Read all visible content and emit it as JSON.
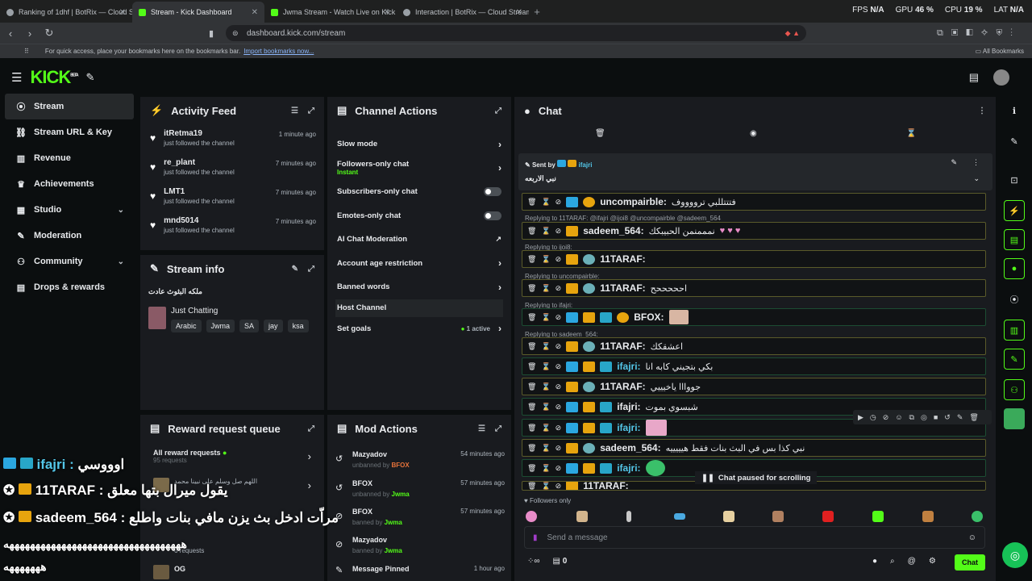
{
  "browser": {
    "tabs": [
      {
        "title": "Ranking of 1dhf | BotRix — Cloud Str"
      },
      {
        "title": "Stream - Kick Dashboard"
      },
      {
        "title": "Jwma Stream - Watch Live on Kick"
      },
      {
        "title": "Interaction | BotRix — Cloud Stream"
      }
    ],
    "url": "dashboard.kick.com/stream",
    "bookmarks_hint": "For quick access, place your bookmarks here on the bookmarks bar.",
    "import_link": "Import bookmarks now...",
    "all_bookmarks": "All Bookmarks",
    "fps_label": "FPS",
    "fps_value": "N/A",
    "gpu_label": "GPU",
    "gpu_value": "46 %",
    "cpu_label": "CPU",
    "cpu_value": "19 %",
    "lat_label": "LAT",
    "lat_value": "N/A"
  },
  "app": {
    "logo": "KICK",
    "logo_beta": "BETA"
  },
  "sidebar": {
    "items": [
      {
        "label": "Stream",
        "icon": "broadcast-icon"
      },
      {
        "label": "Stream URL & Key",
        "icon": "link-icon"
      },
      {
        "label": "Revenue",
        "icon": "bank-icon"
      },
      {
        "label": "Achievements",
        "icon": "trophy-icon"
      },
      {
        "label": "Studio",
        "icon": "grid-icon"
      },
      {
        "label": "Moderation",
        "icon": "wrench-icon"
      },
      {
        "label": "Community",
        "icon": "people-icon"
      },
      {
        "label": "Drops & rewards",
        "icon": "gift-icon"
      }
    ]
  },
  "activity": {
    "title": "Activity Feed",
    "items": [
      {
        "name": "itRetma19",
        "sub": "just followed the channel",
        "time": "1 minute ago"
      },
      {
        "name": "re_plant",
        "sub": "just followed the channel",
        "time": "7 minutes ago"
      },
      {
        "name": "LMT1",
        "sub": "just followed the channel",
        "time": "7 minutes ago"
      },
      {
        "name": "mnd5014",
        "sub": "just followed the channel",
        "time": "7 minutes ago"
      }
    ]
  },
  "stream_info": {
    "title": "Stream info",
    "stream_title": "ملكه البثوث عادت",
    "category": "Just Chatting",
    "tags": [
      "Arabic",
      "Jwma",
      "SA",
      "jay",
      "ksa"
    ]
  },
  "channel_actions": {
    "title": "Channel Actions",
    "rows": [
      {
        "label": "Slow mode",
        "sub": "",
        "kind": "arrow"
      },
      {
        "label": "Followers-only chat",
        "sub": "Instant",
        "kind": "arrow"
      },
      {
        "label": "Subscribers-only chat",
        "sub": "",
        "kind": "toggle"
      },
      {
        "label": "Emotes-only chat",
        "sub": "",
        "kind": "toggle"
      },
      {
        "label": "AI Chat Moderation",
        "sub": "",
        "kind": "external"
      },
      {
        "label": "Account age restriction",
        "sub": "",
        "kind": "arrow"
      },
      {
        "label": "Banned words",
        "sub": "",
        "kind": "arrow"
      },
      {
        "label": "Host Channel",
        "sub": "",
        "kind": "none"
      },
      {
        "label": "Set goals",
        "sub": "1 active",
        "kind": "arrow"
      }
    ]
  },
  "reward_queue": {
    "title": "Reward request queue",
    "all_label": "All reward requests",
    "all_count": "95 requests",
    "items": [
      {
        "label": "اللهم صل وسلم على نبينا محمد",
        "sub": ""
      },
      {
        "label": "",
        "sub": "6 requests"
      },
      {
        "label": "OG",
        "sub": ""
      }
    ]
  },
  "mod_actions": {
    "title": "Mod Actions",
    "items": [
      {
        "name": "Mazyadov",
        "verb": "unbanned by",
        "by": "BFOX",
        "time": "54 minutes ago",
        "icon": "undo-icon"
      },
      {
        "name": "BFOX",
        "verb": "unbanned by",
        "by": "Jwma",
        "time": "57 minutes ago",
        "icon": "undo-icon"
      },
      {
        "name": "BFOX",
        "verb": "banned by",
        "by": "Jwma",
        "time": "57 minutes ago",
        "icon": "ban-icon"
      },
      {
        "name": "Mazyadov",
        "verb": "banned by",
        "by": "Jwma",
        "time": "",
        "icon": "ban-icon"
      },
      {
        "name": "Message Pinned",
        "verb": "",
        "by": "",
        "time": "1 hour ago",
        "icon": "pin-icon"
      }
    ]
  },
  "chat": {
    "title": "Chat",
    "pinned_by_label": "Sent by",
    "pinned_user": "ifajri",
    "pinned_text": "نبي الاربعه",
    "paused": "Chat paused for scrolling",
    "followers_only": "Followers only",
    "input_placeholder": "Send a message",
    "send_label": "Chat",
    "viewer_count": "0",
    "messages": [
      {
        "reply": "",
        "user": "uncompairble:",
        "text": "فتتتللبي ترووووف",
        "color": "#ffffff",
        "badges": [
          "mod",
          "sub1"
        ]
      },
      {
        "reply": "Replying to 11TARAF: @ifajri @ijoi8 @uncompairble @sadeem_564",
        "user": "sadeem_564:",
        "text": "نمممنمن الحبيبكك",
        "color": "#ffffff",
        "badges": [
          "crown"
        ]
      },
      {
        "reply": "Replying to ijoi8:",
        "user": "11TARAF:",
        "text": "",
        "color": "#ffffff",
        "badges": [
          "crown",
          "sub"
        ]
      },
      {
        "reply": "Replying to uncompairble:",
        "user": "11TARAF:",
        "text": "احححححح",
        "color": "#ffffff",
        "badges": [
          "crown",
          "sub"
        ]
      },
      {
        "reply": "Replying to ifajri:",
        "user": "BFOX:",
        "text": "",
        "color": "#ffffff",
        "badges": [
          "mod",
          "crown",
          "og",
          "sub1"
        ]
      },
      {
        "reply": "Replying to sadeem_564:",
        "user": "11TARAF:",
        "text": "اعشقكك",
        "color": "#ffffff",
        "badges": [
          "crown",
          "sub"
        ]
      },
      {
        "reply": "",
        "user": "ifajri:",
        "text": "بكي بتجيني كابه انا",
        "color": "#53c6e8",
        "badges": [
          "mod",
          "crown",
          "og"
        ]
      },
      {
        "reply": "",
        "user": "11TARAF:",
        "text": "جووااا ياخيييي",
        "color": "#ffffff",
        "badges": [
          "crown",
          "sub"
        ]
      },
      {
        "reply": "",
        "user": "ifajri:",
        "text": "شبسوي بموت",
        "color": "#ffffff",
        "badges": [
          "mod",
          "crown",
          "og"
        ]
      },
      {
        "reply": "",
        "user": "ifajri:",
        "text": "",
        "color": "#53c6e8",
        "badges": [
          "mod",
          "crown",
          "og"
        ]
      },
      {
        "reply": "",
        "user": "sadeem_564:",
        "text": "نبي كذا بس في البث بنات فقط هيييييه",
        "color": "#ffffff",
        "badges": [
          "crown",
          "sub"
        ]
      },
      {
        "reply": "",
        "user": "ifajri:",
        "text": "",
        "color": "#53c6e8",
        "badges": [
          "mod",
          "crown",
          "og"
        ]
      },
      {
        "reply": "",
        "user": "11TARAF:",
        "text": "",
        "color": "#ffffff",
        "badges": [
          "crown",
          "sub"
        ]
      }
    ]
  },
  "overlay": {
    "lines": [
      {
        "user": "ifajri :",
        "text": "اوووسي"
      },
      {
        "user": "11TARAF :",
        "text": "يقول ميرال بتها معلق"
      },
      {
        "user": "sadeem_564 :",
        "text": "مراّت ادخل بث يزن مافي بنات واطلع"
      }
    ],
    "junk1": "ههههههههههههههههههههههههههههههههههه",
    "junk2": "هههههههه"
  },
  "colors": {
    "accent": "#53fc18",
    "panel": "#191b1f",
    "bg": "#0b0e0f"
  }
}
